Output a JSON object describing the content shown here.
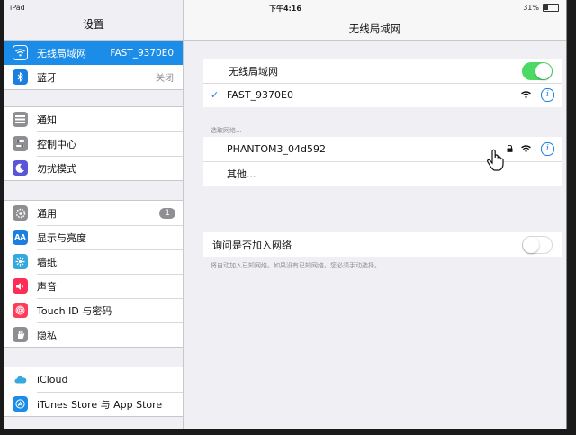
{
  "status_bar": {
    "device": "iPad",
    "time": "下午4:16",
    "battery": "31%",
    "battery_level": 0.31
  },
  "sidebar": {
    "title": "设置",
    "groups": [
      {
        "items": [
          {
            "icon": "wifi-icon",
            "color": "#1b8ce8",
            "label": "无线局域网",
            "value": "FAST_9370E0",
            "selected": true
          },
          {
            "icon": "bluetooth-icon",
            "color": "#1b7fe0",
            "label": "蓝牙",
            "value": "关闭"
          }
        ]
      },
      {
        "items": [
          {
            "icon": "notifications-icon",
            "color": "#8e8e93",
            "label": "通知"
          },
          {
            "icon": "control-center-icon",
            "color": "#8e8e93",
            "label": "控制中心"
          },
          {
            "icon": "do-not-disturb-icon",
            "color": "#5856d6",
            "label": "勿扰模式"
          }
        ]
      },
      {
        "items": [
          {
            "icon": "general-icon",
            "color": "#8e8e93",
            "label": "通用",
            "badge": "1"
          },
          {
            "icon": "display-brightness-icon",
            "color": "#1b7fe0",
            "label": "显示与亮度"
          },
          {
            "icon": "wallpaper-icon",
            "color": "#35a8e0",
            "label": "墙纸"
          },
          {
            "icon": "sounds-icon",
            "color": "#ff2d55",
            "label": "声音"
          },
          {
            "icon": "touch-id-icon",
            "color": "#ff3b5c",
            "label": "Touch ID 与密码"
          },
          {
            "icon": "privacy-icon",
            "color": "#8e8e93",
            "label": "隐私"
          }
        ]
      },
      {
        "items": [
          {
            "icon": "icloud-icon",
            "color": "#ffffff",
            "label": "iCloud"
          },
          {
            "icon": "itunes-store-icon",
            "color": "#1b8ce8",
            "label": "iTunes Store 与 App Store"
          }
        ]
      }
    ]
  },
  "main": {
    "title": "无线局域网",
    "wifi_toggle_label": "无线局域网",
    "wifi_on": true,
    "connected_network": "FAST_9370E0",
    "choose_network_label": "选取网络...",
    "networks": [
      {
        "name": "PHANTOM3_04d592",
        "locked": true
      }
    ],
    "other_label": "其他...",
    "ask_to_join_label": "询问是否加入网络",
    "ask_to_join_on": false,
    "ask_note": "将自动加入已知网络。如果没有已知网络，您必须手动选择。"
  }
}
